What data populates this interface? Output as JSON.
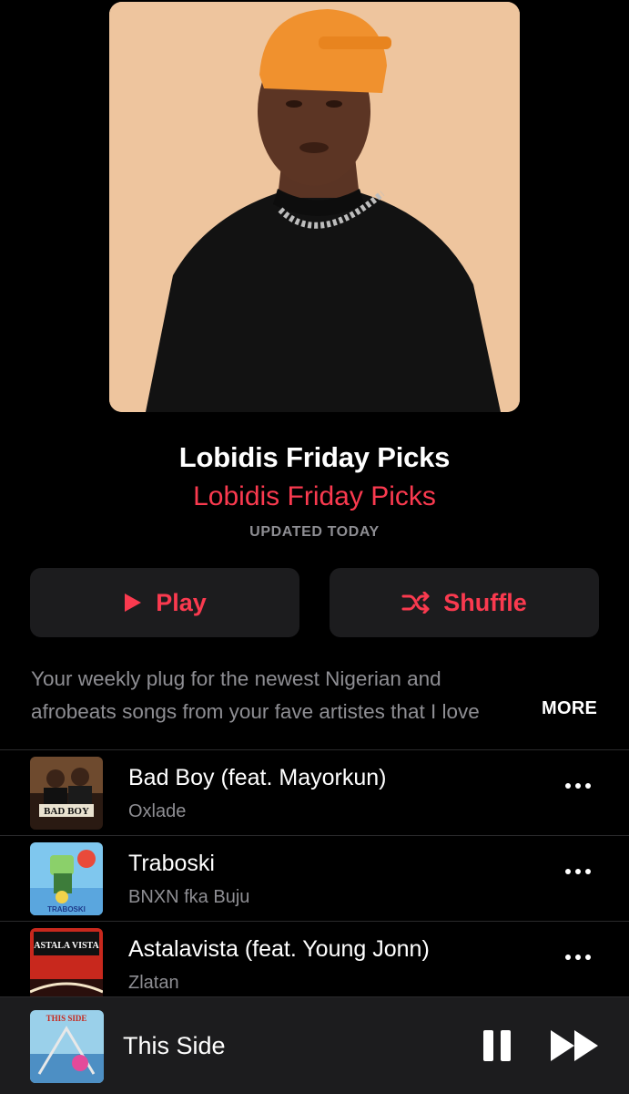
{
  "playlist": {
    "title": "Lobidis Friday Picks",
    "curator": "Lobidis Friday Picks",
    "updated": "UPDATED TODAY"
  },
  "actions": {
    "play_label": "Play",
    "shuffle_label": "Shuffle"
  },
  "description": {
    "line1": "Your weekly plug for the newest Nigerian and",
    "line2": "afrobeats songs from your fave artistes that I love",
    "more_label": "MORE"
  },
  "tracks": [
    {
      "title": "Bad Boy (feat. Mayorkun)",
      "artist": "Oxlade",
      "art_text": "BAD BOY"
    },
    {
      "title": "Traboski",
      "artist": "BNXN fka Buju",
      "art_text": "TRABOSKI"
    },
    {
      "title": "Astalavista (feat. Young Jonn)",
      "artist": "Zlatan",
      "art_text": "ASTALA VISTA"
    }
  ],
  "now_playing": {
    "title": "This Side",
    "art_text": "THIS SIDE"
  },
  "colors": {
    "accent": "#fa3a4f",
    "secondary_text": "#8e8e93",
    "surface": "#1c1c1e",
    "background": "#000000"
  },
  "icons": {
    "play": "play-triangle-icon",
    "shuffle": "shuffle-icon",
    "more": "ellipsis-icon",
    "pause": "pause-icon",
    "forward": "fast-forward-icon"
  }
}
